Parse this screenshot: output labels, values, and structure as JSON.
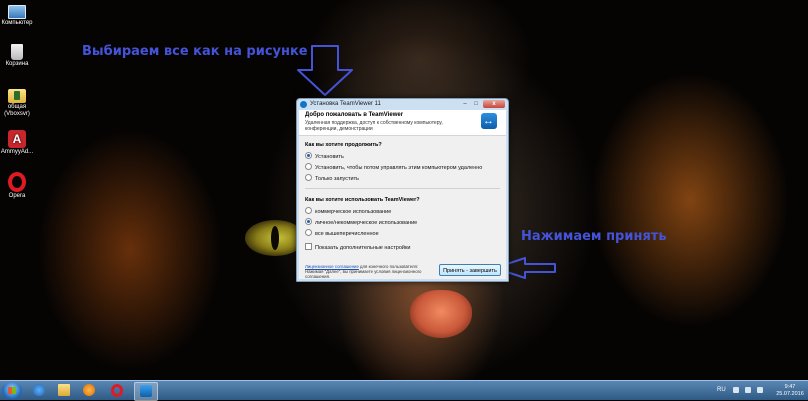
{
  "desktop": {
    "icons": [
      {
        "label": "Компьютер",
        "icon": "computer-icon"
      },
      {
        "label": "Корзина",
        "icon": "recycle-bin-icon"
      },
      {
        "label": "общая (Vboxsvr)",
        "icon": "shared-folder-icon"
      },
      {
        "label": "AmmyyAd...",
        "icon": "ammyy-admin-icon"
      },
      {
        "label": "Opera",
        "icon": "opera-icon"
      }
    ]
  },
  "annotations": {
    "select_all": "Выбираем все как на рисунке",
    "press_accept": "Нажимаем принять"
  },
  "colors": {
    "annotation": "#4453d8",
    "accent": "#1173c9",
    "taskbar": "#2f5a86"
  },
  "dialog": {
    "title": "Установка TeamViewer 11",
    "close_glyph": "x",
    "header_title": "Добро пожаловать в TeamViewer",
    "header_subtitle": "Удаленная поддержка, доступ к собственному компьютеру, конференции, демонстрации",
    "q1": "Как вы хотите продолжить?",
    "q1_options": [
      {
        "label": "Установить",
        "selected": true
      },
      {
        "label": "Установить, чтобы потом управлять этим компьютером удаленно",
        "selected": false
      },
      {
        "label": "Только запустить",
        "selected": false
      }
    ],
    "q2": "Как вы хотите использовать TeamViewer?",
    "q2_options": [
      {
        "label": "коммерческое использование",
        "selected": false
      },
      {
        "label": "личное/некоммерческое использование",
        "selected": true
      },
      {
        "label": "все вышеперечисленное",
        "selected": false
      }
    ],
    "advanced_label": "Показать дополнительные настройки",
    "advanced_checked": false,
    "legal_link": "Лицензионное соглашение",
    "legal_text": "для конечного пользователя: Нажимая \"Далее\", вы принимаете условия лицензионного соглашения.",
    "accept_button": "Принять - завершить"
  },
  "taskbar": {
    "apps": [
      "internet-explorer-icon",
      "explorer-folder-icon",
      "media-player-icon",
      "opera-icon",
      "teamviewer-icon"
    ],
    "language": "RU",
    "time": "9:47",
    "date": "25.07.2016"
  }
}
